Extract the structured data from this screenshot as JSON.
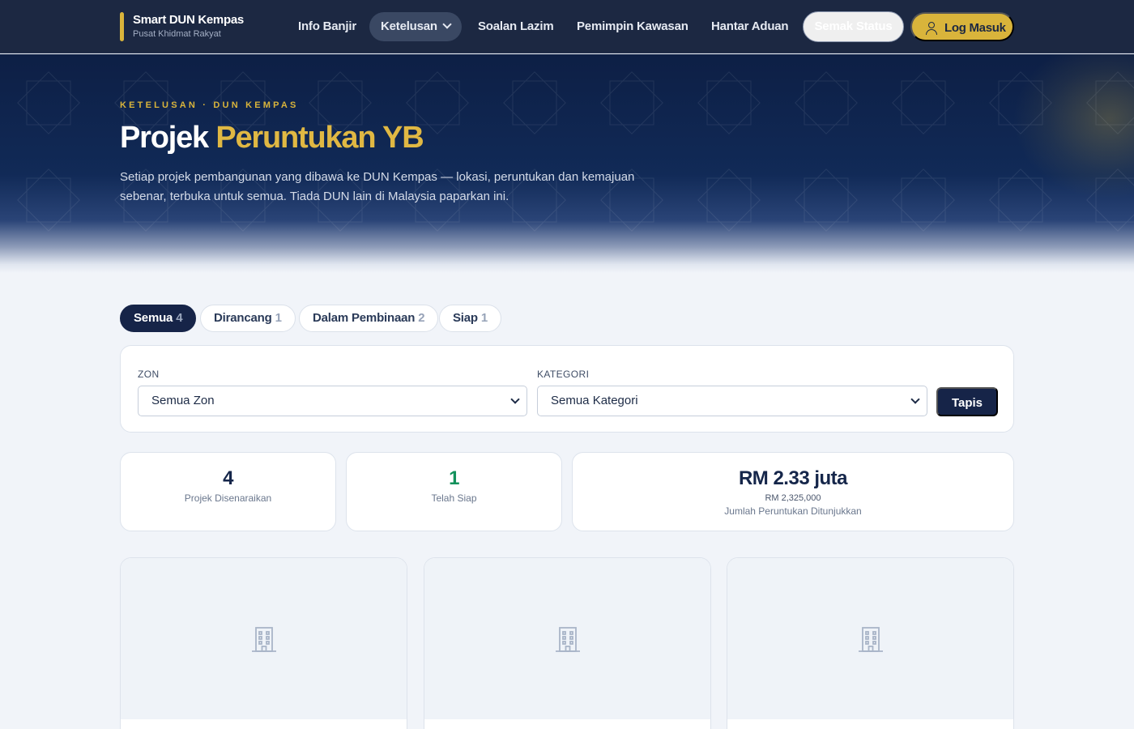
{
  "brand": {
    "title": "Smart DUN Kempas",
    "subtitle": "Pusat Khidmat Rakyat"
  },
  "nav": {
    "links": [
      {
        "label": "Info Banjir"
      },
      {
        "label": "Ketelusan",
        "active": true,
        "icon": "chevron-down-icon"
      },
      {
        "label": "Soalan Lazim"
      },
      {
        "label": "Pemimpin Kawasan"
      },
      {
        "label": "Hantar Aduan"
      }
    ],
    "status_button": "Semak Status",
    "login_button": "Log Masuk",
    "login_icon": "user-icon"
  },
  "hero": {
    "eyebrow": "KETELUSAN · DUN KEMPAS",
    "title_part1": "Projek",
    "title_part2": "Peruntukan YB",
    "description": "Setiap projek pembangunan yang dibawa ke DUN Kempas — lokasi, peruntukan dan kemajuan sebenar, terbuka untuk semua. Tiada DUN lain di Malaysia paparkan ini."
  },
  "tabs": [
    {
      "label": "Semua",
      "count": "4",
      "active": true
    },
    {
      "label": "Dirancang",
      "count": "1"
    },
    {
      "label": "Dalam Pembinaan",
      "count": "2"
    },
    {
      "label": "Siap",
      "count": "1"
    }
  ],
  "filters": {
    "zone_label": "ZON",
    "zone_value": "Semua Zon",
    "category_label": "KATEGORI",
    "category_value": "Semua Kategori",
    "submit_label": "Tapis"
  },
  "stats": {
    "listed": {
      "value": "4",
      "label": "Projek Disenaraikan"
    },
    "completed": {
      "value": "1",
      "label": "Telah Siap"
    },
    "allocation": {
      "value": "RM 2.33 juta",
      "sub": "RM 2,325,000",
      "label": "Jumlah Peruntukan Ditunjukkan"
    }
  },
  "projects": [
    {
      "image_icon": "building-icon"
    },
    {
      "image_icon": "building-icon"
    },
    {
      "image_icon": "building-icon"
    }
  ],
  "colors": {
    "navy": "#1c2842",
    "gold": "#d9b43b",
    "dark_button": "#162448",
    "success_green": "#12915b",
    "page_bg": "#f1f4f9"
  }
}
